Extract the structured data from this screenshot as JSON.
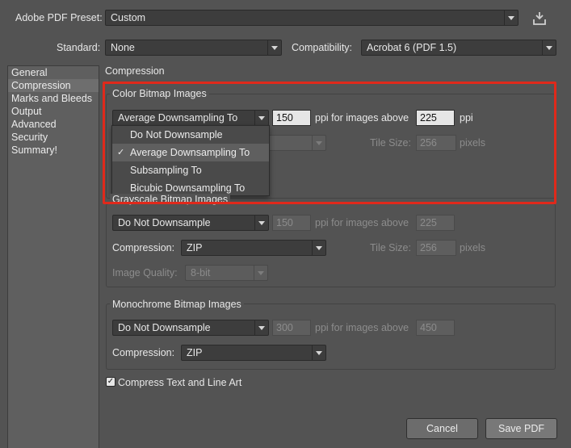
{
  "preset": {
    "label": "Adobe PDF Preset:",
    "value": "Custom",
    "save_icon": "save-preset-icon"
  },
  "standard": {
    "label": "Standard:",
    "value": "None"
  },
  "compatibility": {
    "label": "Compatibility:",
    "value": "Acrobat 6 (PDF 1.5)"
  },
  "nav": {
    "items": [
      "General",
      "Compression",
      "Marks and Bleeds",
      "Output",
      "Advanced",
      "Security",
      "Summary!"
    ],
    "selected": "Compression"
  },
  "panel_title": "Compression",
  "color": {
    "title": "Color Bitmap Images",
    "sampling": "Average Downsampling To",
    "ppi": "150",
    "ppi_label": "ppi for images above",
    "above": "225",
    "ppi_unit": "ppi",
    "tile_label": "Tile Size:",
    "tile_value": "256",
    "tile_unit": "pixels",
    "menu": {
      "items": [
        "Do Not Downsample",
        "Average Downsampling To",
        "Subsampling To",
        "Bicubic Downsampling To"
      ],
      "checked": "Average Downsampling To",
      "check_glyph": "✓"
    }
  },
  "grayscale": {
    "title": "Grayscale Bitmap Images",
    "sampling": "Do Not Downsample",
    "ppi": "150",
    "ppi_label": "ppi for images above",
    "above": "225",
    "compression_label": "Compression:",
    "compression": "ZIP",
    "tile_label": "Tile Size:",
    "tile_value": "256",
    "tile_unit": "pixels",
    "quality_label": "Image Quality:",
    "quality": "8-bit"
  },
  "monochrome": {
    "title": "Monochrome Bitmap Images",
    "sampling": "Do Not Downsample",
    "ppi": "300",
    "ppi_label": "ppi for images above",
    "above": "450",
    "compression_label": "Compression:",
    "compression": "ZIP"
  },
  "compress_text": {
    "label": "Compress Text and Line Art",
    "checked": true,
    "check_glyph": "✓"
  },
  "buttons": {
    "cancel": "Cancel",
    "save": "Save PDF"
  },
  "colors": {
    "highlight": "#e0291b",
    "background": "#535353"
  }
}
